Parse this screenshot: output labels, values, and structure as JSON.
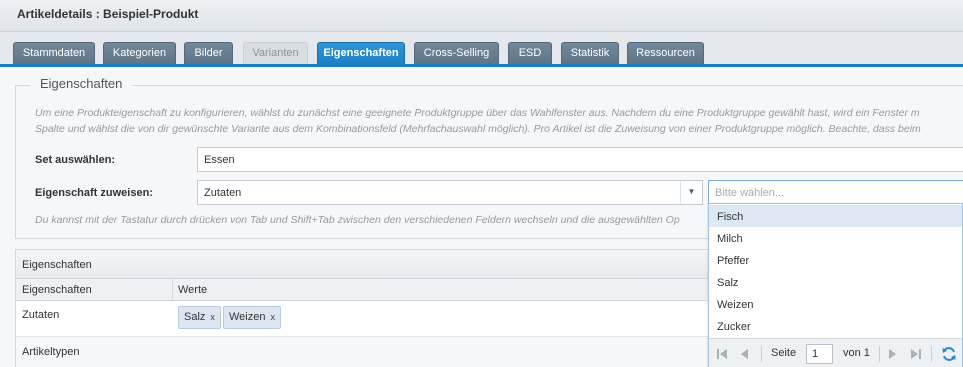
{
  "window": {
    "title": "Artikeldetails : Beispiel-Produkt"
  },
  "tabs": [
    {
      "label": "Stammdaten",
      "state": "normal"
    },
    {
      "label": "Kategorien",
      "state": "normal"
    },
    {
      "label": "Bilder",
      "state": "normal"
    },
    {
      "label": "Varianten",
      "state": "disabled"
    },
    {
      "label": "Eigenschaften",
      "state": "active"
    },
    {
      "label": "Cross-Selling",
      "state": "normal"
    },
    {
      "label": "ESD",
      "state": "normal"
    },
    {
      "label": "Statistik",
      "state": "normal"
    },
    {
      "label": "Ressourcen",
      "state": "normal"
    }
  ],
  "fieldset": {
    "legend": "Eigenschaften",
    "hint_line1": "Um eine Produkteigenschaft zu konfigurieren, wählst du zunächst eine geeignete Produktgruppe über das Wahlfenster aus. Nachdem du eine Produktgruppe gewählt hast, wird ein Fenster m",
    "hint_line2": "Spalte und wählst die von dir gewünschte Variante aus dem Kombinationsfeld (Mehrfachauswahl möglich). Pro Artikel ist die Zuweisung von einer Produktgruppe möglich. Beachte, dass beim",
    "set_label": "Set auswählen:",
    "set_value": "Essen",
    "assign_label": "Eigenschaft zuweisen:",
    "assign_value": "Zutaten",
    "assign_trigger": "▼",
    "value_placeholder": "Bitte wählen...",
    "keyboard_hint": "Du kannst mit der Tastatur durch drücken von Tab und Shift+Tab zwischen den verschiedenen Feldern wechseln und die ausgewählten Op"
  },
  "grid": {
    "title": "Eigenschaften",
    "columns": [
      "Eigenschaften",
      "Werte"
    ],
    "row": {
      "name": "Zutaten",
      "tags": [
        "Salz",
        "Weizen"
      ],
      "tag_remove": "x"
    },
    "group": "Artikeltypen"
  },
  "dropdown": {
    "items": [
      "Fisch",
      "Milch",
      "Pfeffer",
      "Salz",
      "Weizen",
      "Zucker"
    ],
    "pager": {
      "page_label": "Seite",
      "page": "1",
      "of_label": "von 1"
    }
  }
}
